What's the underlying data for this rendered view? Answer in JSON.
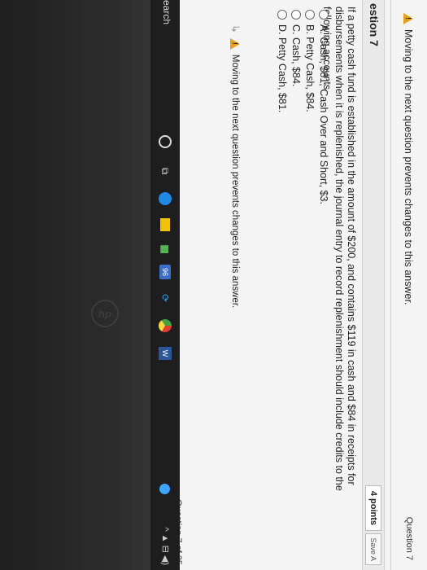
{
  "warnings": {
    "top": "Moving to the next question prevents changes to this answer.",
    "bottom": "Moving to the next question prevents changes to this answer."
  },
  "nav": {
    "question_label": "Question 7"
  },
  "question": {
    "title": "estion 7",
    "points": "4 points",
    "save_label": "Save A",
    "text": "If a petty cash fund is established in the amount of $200, and contains $119 in cash and $84 in receipts for disbursements when it is replenished, the journal entry to record replenishment should include credits to the following accounts",
    "options": [
      "A. Cash, $81; Cash Over and Short, $3.",
      "B. Petty Cash, $84.",
      "C. Cash, $84.",
      "D. Petty Cash, $81."
    ],
    "count_label": "Question 7 of 25"
  },
  "taskbar": {
    "search_label": "earch",
    "badge_count": "96",
    "word_label": "W"
  },
  "bezel": {
    "logo_text": "hp"
  }
}
